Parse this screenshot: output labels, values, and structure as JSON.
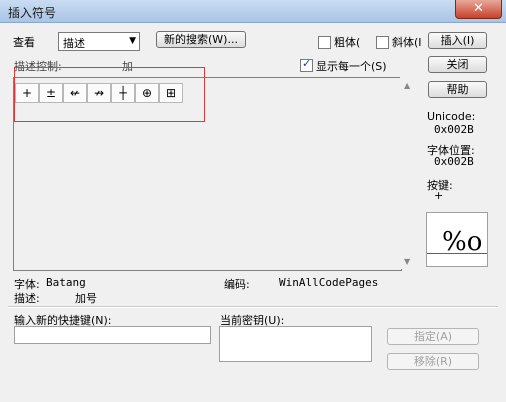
{
  "window": {
    "title": "插入符号",
    "close_glyph": "✕"
  },
  "toolbar": {
    "view_label": "查看",
    "view_select_value": "描述",
    "new_search_button": "新的搜索(W)...",
    "bold_label": "粗体(",
    "italic_label": "斜体(I",
    "insert_button": "插入(I)",
    "close_button": "关闭",
    "help_button": "帮助"
  },
  "description_row": {
    "label": "描述控制:",
    "value": "加",
    "show_each_label": "显示每一个(S)",
    "show_each_checked": true
  },
  "symbols": [
    {
      "glyph": "+",
      "icon": "plus-icon"
    },
    {
      "glyph": "±",
      "icon": "plus-minus-icon"
    },
    {
      "glyph": "↚",
      "icon": "left-arrow-stroke-icon"
    },
    {
      "glyph": "↛",
      "icon": "right-arrow-stroke-icon"
    },
    {
      "glyph": "┼",
      "icon": "cross-icon"
    },
    {
      "glyph": "⊕",
      "icon": "circled-plus-icon"
    },
    {
      "glyph": "⊞",
      "icon": "squared-plus-icon"
    }
  ],
  "info": {
    "unicode_label": "Unicode:",
    "unicode_value": "0x002B",
    "char_pos_label": "字体位置:",
    "char_pos_value": "0x002B",
    "key_label": "按键:",
    "key_value": "+",
    "preview_glyph": "%o"
  },
  "font_info": {
    "font_label": "字体:",
    "font_value": "Batang",
    "encoding_label": "编码:",
    "encoding_value": "WinAllCodePages",
    "desc_label": "描述:",
    "desc_value": "加号"
  },
  "shortcut": {
    "new_key_label": "输入新的快捷键(N):",
    "current_key_label": "当前密钥(U):",
    "assign_button": "指定(A)",
    "remove_button": "移除(R)"
  }
}
